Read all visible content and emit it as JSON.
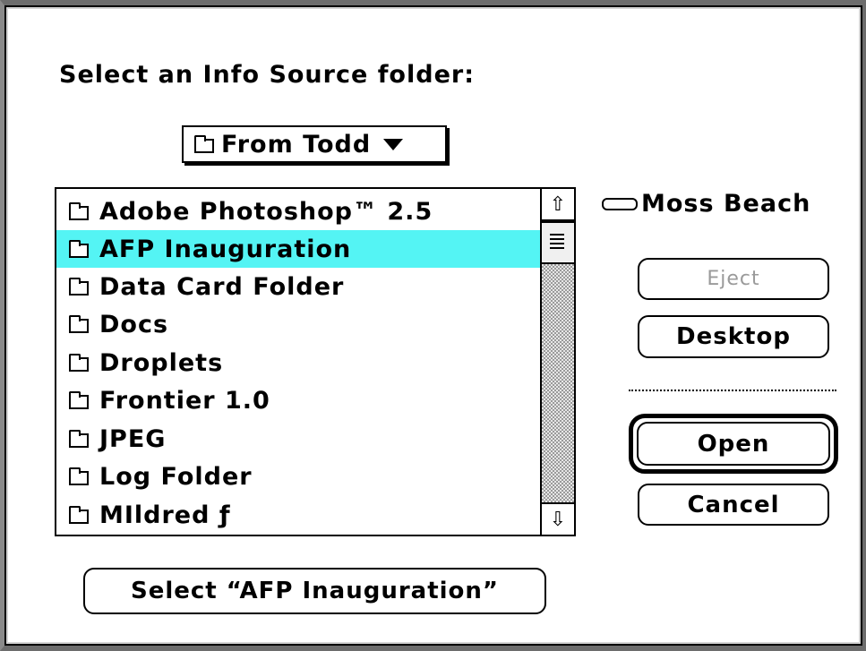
{
  "dialog": {
    "prompt": "Select an Info Source folder:"
  },
  "popup": {
    "label": "From Todd",
    "icon": "open-folder-icon"
  },
  "list": {
    "items": [
      {
        "label": "Adobe Photoshop™ 2.5",
        "icon": "folder-icon",
        "selected": false
      },
      {
        "label": "AFP Inauguration",
        "icon": "folder-icon",
        "selected": true
      },
      {
        "label": "Data Card Folder",
        "icon": "folder-icon",
        "selected": false
      },
      {
        "label": "Docs",
        "icon": "folder-icon",
        "selected": false
      },
      {
        "label": "Droplets",
        "icon": "folder-icon",
        "selected": false
      },
      {
        "label": "Frontier 1.0",
        "icon": "folder-icon",
        "selected": false
      },
      {
        "label": "JPEG",
        "icon": "folder-icon",
        "selected": false
      },
      {
        "label": "Log Folder",
        "icon": "folder-icon",
        "selected": false
      },
      {
        "label": "MIldred ƒ",
        "icon": "folder-icon",
        "selected": false
      }
    ],
    "selection_color": "#54f4f4"
  },
  "volume": {
    "name": "Moss Beach",
    "icon": "hard-disk-icon"
  },
  "buttons": {
    "eject": "Eject",
    "desktop": "Desktop",
    "open": "Open",
    "cancel": "Cancel",
    "select": "Select “AFP Inauguration”"
  }
}
